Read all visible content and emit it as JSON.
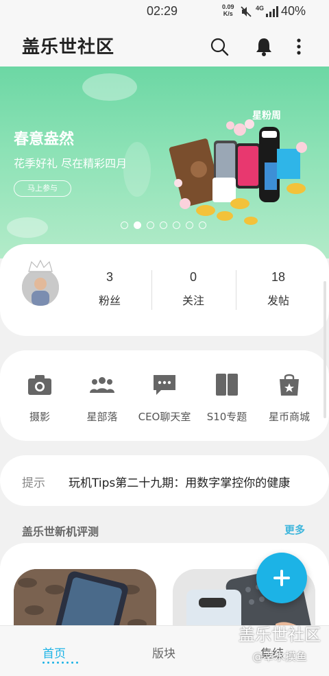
{
  "status_bar": {
    "time": "02:29",
    "net_speed_value": "0.09",
    "net_speed_unit": "K/s",
    "network": "4G",
    "battery": "40%"
  },
  "header": {
    "title": "盖乐世社区",
    "search_icon": "search-icon",
    "bell_icon": "bell-icon",
    "more_icon": "more-vertical-icon"
  },
  "banner": {
    "headline": "春意盎然",
    "subtitle": "花季好礼 尽在精彩四月",
    "button_label": "马上参与",
    "badge_text": "星粉周",
    "slide_count": 7,
    "active_slide": 2
  },
  "profile": {
    "stats": [
      {
        "value": "3",
        "label": "粉丝"
      },
      {
        "value": "0",
        "label": "关注"
      },
      {
        "value": "18",
        "label": "发帖"
      }
    ]
  },
  "shortcuts": [
    {
      "label": "摄影",
      "icon": "camera-icon"
    },
    {
      "label": "星部落",
      "icon": "group-icon"
    },
    {
      "label": "CEO聊天室",
      "icon": "chat-icon"
    },
    {
      "label": "S10专题",
      "icon": "phones-icon"
    },
    {
      "label": "星币商城",
      "icon": "shopping-bag-icon"
    }
  ],
  "notice": {
    "tag": "提示",
    "text": "玩机Tips第二十九期：用数字掌控你的健康"
  },
  "reviews_section": {
    "title": "盖乐世新机评测",
    "more_label": "更多"
  },
  "fab": {
    "icon": "plus-icon"
  },
  "bottom_nav": [
    {
      "label": "首页",
      "active": true
    },
    {
      "label": "版块",
      "active": false
    },
    {
      "label": "集结",
      "active": false
    }
  ],
  "watermark": {
    "line1": "盖乐世社区",
    "line2": "@莘水摸鱼"
  },
  "colors": {
    "accent": "#1cb3e6",
    "banner_green": "#6cd7a4",
    "more_link": "#3fb6dc"
  }
}
